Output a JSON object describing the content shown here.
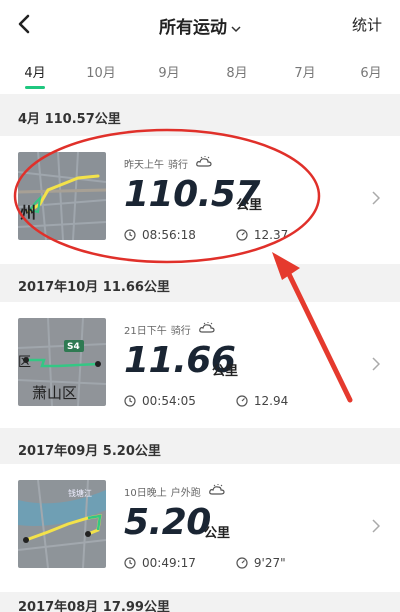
{
  "header": {
    "title": "所有运动",
    "stats_label": "统计"
  },
  "tabs": [
    "4月",
    "10月",
    "9月",
    "8月",
    "7月",
    "6月"
  ],
  "sections": [
    {
      "header": "4月   110.57公里",
      "meta_time": "昨天上午",
      "sport": "骑行",
      "distance": "110.57",
      "unit": "公里",
      "duration": "08:56:18",
      "second_value": "12.37"
    },
    {
      "header": "2017年10月   11.66公里",
      "meta_time": "21日下午",
      "sport": "骑行",
      "distance": "11.66",
      "unit": "公里",
      "duration": "00:54:05",
      "second_value": "12.94"
    },
    {
      "header": "2017年09月   5.20公里",
      "meta_time": "10日晚上",
      "sport": "户外跑",
      "distance": "5.20",
      "unit": "公里",
      "duration": "00:49:17",
      "second_value": "9'27\""
    }
  ],
  "footer_header": "2017年08月   17.99公里",
  "map_labels": {
    "map1_text": "州",
    "map2_badge": "S4",
    "map2_text": "萧山区",
    "map2_text2": "区",
    "map3_text": "钱塘江"
  }
}
